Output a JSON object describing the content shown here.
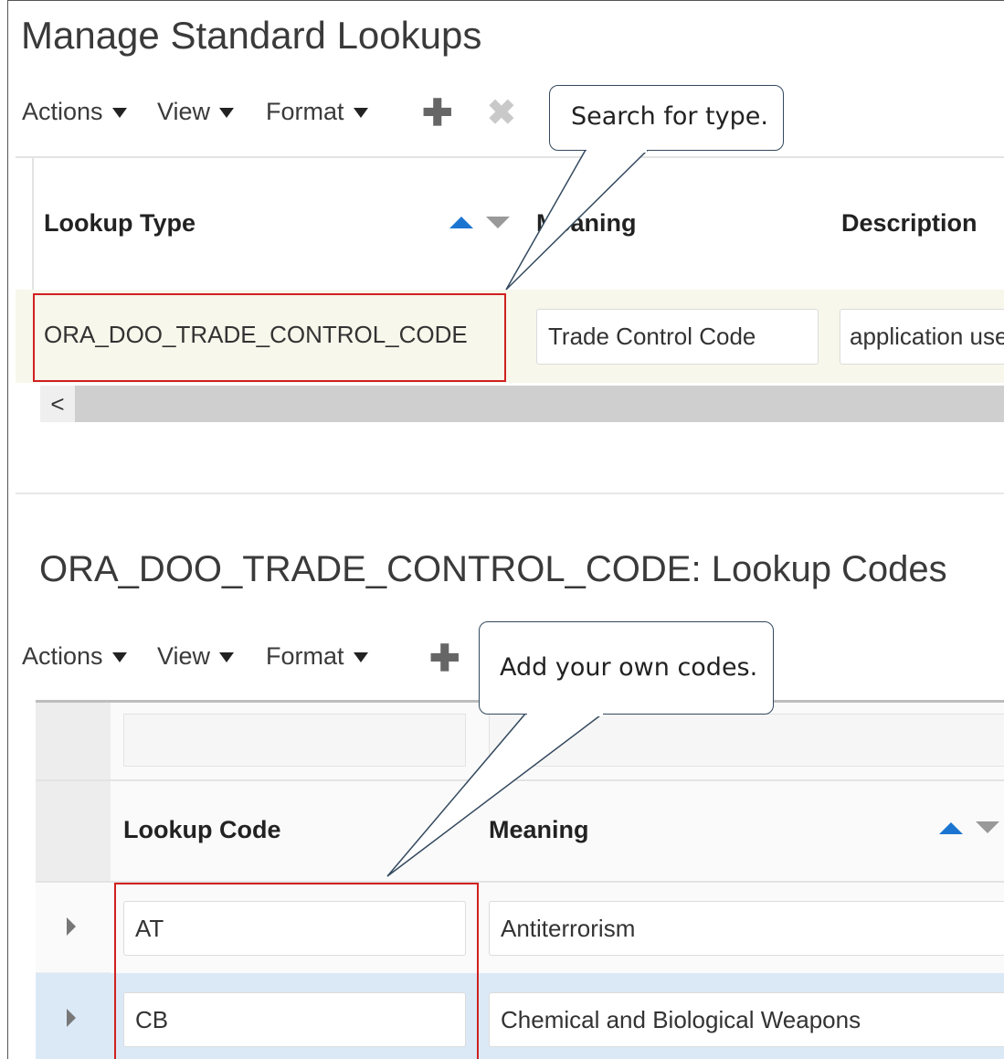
{
  "page": {
    "title": "Manage Standard Lookups"
  },
  "toolbar1": {
    "actions": "Actions",
    "view": "View",
    "format": "Format"
  },
  "table1": {
    "headers": {
      "lookup_type": "Lookup Type",
      "meaning": "Meaning",
      "description": "Description"
    },
    "row": {
      "lookup_type": "ORA_DOO_TRADE_CONTROL_CODE",
      "meaning": "Trade Control Code",
      "description": "application use"
    },
    "scroll_left": "<"
  },
  "section2": {
    "title": "ORA_DOO_TRADE_CONTROL_CODE: Lookup Codes"
  },
  "toolbar2": {
    "actions": "Actions",
    "view": "View",
    "format": "Format"
  },
  "table2": {
    "headers": {
      "lookup_code": "Lookup Code",
      "meaning": "Meaning"
    },
    "rows": [
      {
        "code": "AT",
        "meaning": "Antiterrorism"
      },
      {
        "code": "CB",
        "meaning": "Chemical and Biological Weapons"
      }
    ]
  },
  "callouts": {
    "search": "Search for type.",
    "add": "Add your own codes."
  },
  "icons": {
    "add": "plus-icon",
    "delete": "x-icon",
    "sort": "sort-icon",
    "expand": "row-expand-icon"
  },
  "colors": {
    "accent": "#1b75d0",
    "highlight_row": "#f7f7eb",
    "selected_row": "#dbe9f7",
    "red_box": "#d02020"
  }
}
